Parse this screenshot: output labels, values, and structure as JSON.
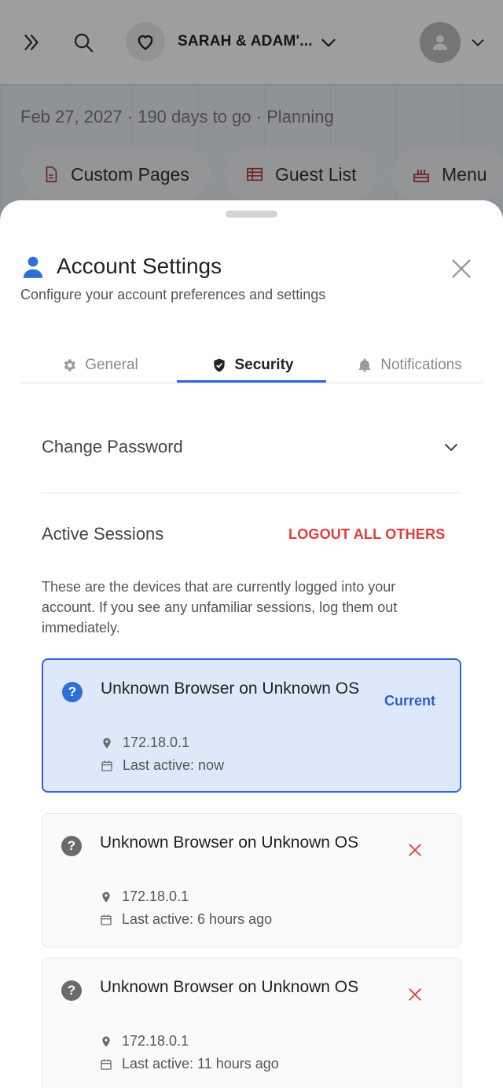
{
  "background": {
    "header_title": "SARAH & ADAM'...",
    "subtitle": "Feb 27, 2027 · 190 days to go · Planning",
    "chips": [
      {
        "label": "Custom Pages",
        "icon": "document-icon"
      },
      {
        "label": "Guest List",
        "icon": "table-icon"
      },
      {
        "label": "Menu",
        "icon": "cake-icon"
      }
    ]
  },
  "modal": {
    "title": "Account Settings",
    "description": "Configure your account preferences and settings",
    "tabs": [
      {
        "label": "General",
        "icon": "gear-icon",
        "active": false
      },
      {
        "label": "Security",
        "icon": "shield-icon",
        "active": true
      },
      {
        "label": "Notifications",
        "icon": "bell-icon",
        "active": false
      }
    ],
    "change_password": {
      "label": "Change Password"
    },
    "active_sessions": {
      "title": "Active Sessions",
      "logout_all_label": "LOGOUT ALL OTHERS",
      "description": "These are the devices that are currently logged into your account. If you see any unfamiliar sessions, log them out immediately.",
      "sessions": [
        {
          "name": "Unknown Browser on Unknown OS",
          "ip": "172.18.0.1",
          "last_active": "Last active: now",
          "current": true,
          "current_label": "Current"
        },
        {
          "name": "Unknown Browser on Unknown OS",
          "ip": "172.18.0.1",
          "last_active": "Last active: 6 hours ago",
          "current": false
        },
        {
          "name": "Unknown Browser on Unknown OS",
          "ip": "172.18.0.1",
          "last_active": "Last active: 11 hours ago",
          "current": false
        }
      ]
    }
  },
  "colors": {
    "accent": "#3066d6",
    "danger": "#e23b3b",
    "current_bg": "#dde9fb"
  }
}
